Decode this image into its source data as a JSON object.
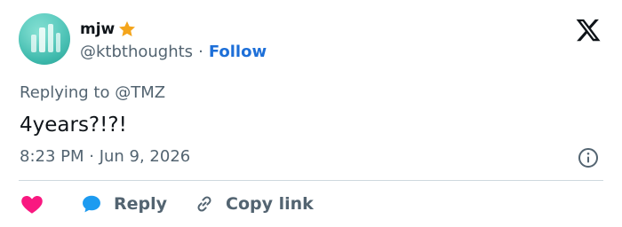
{
  "author": {
    "name": "mjw",
    "handle": "@ktbthoughts",
    "separator": "·",
    "follow_label": "Follow",
    "badge_icon": "star-icon"
  },
  "tweet": {
    "replying_prefix": "Replying to",
    "replying_to": "@TMZ",
    "text": "4years?!?!",
    "timestamp": "8:23 PM · Jun 9, 2026"
  },
  "actions": {
    "like_icon": "heart-icon",
    "reply_label": "Reply",
    "copy_label": "Copy link"
  },
  "colors": {
    "accent": "#1d6fd8",
    "muted_text": "#536471",
    "heart": "#f91880",
    "reply_bubble": "#1d9bf0",
    "star": "#f4a51c"
  }
}
